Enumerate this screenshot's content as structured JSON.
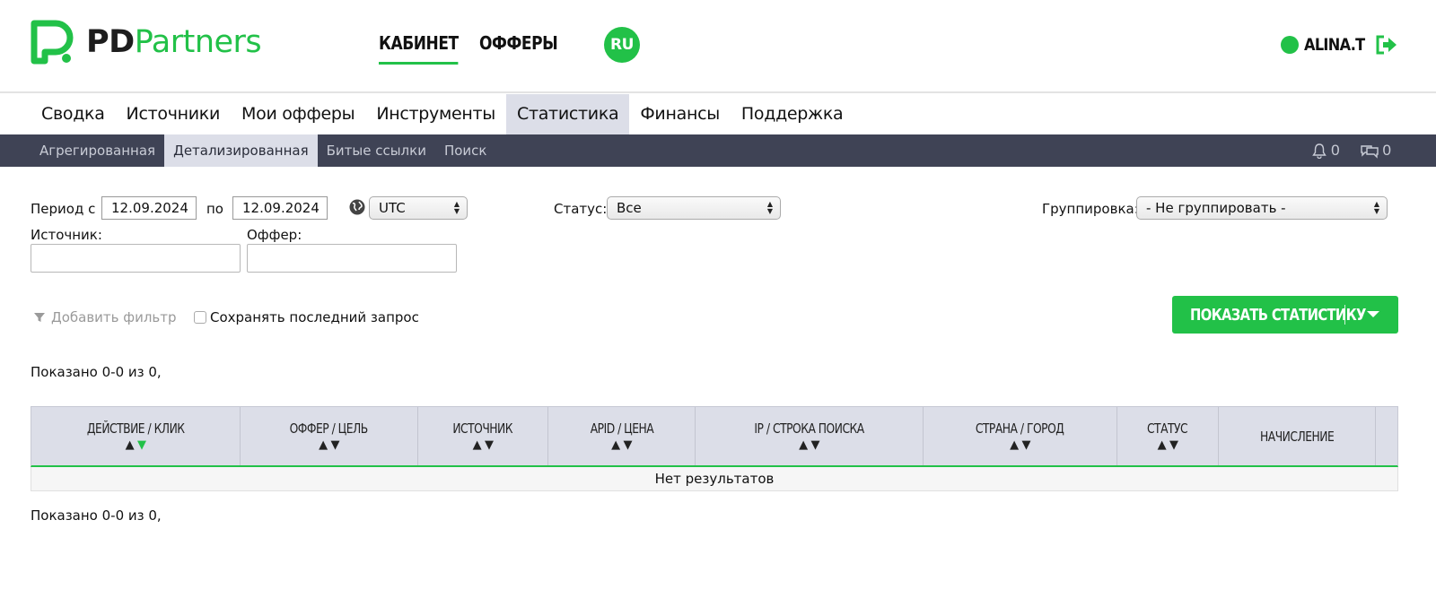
{
  "header": {
    "logo_pd": "PD",
    "logo_partners": "Partners",
    "nav": [
      {
        "label": "КАБИНЕТ",
        "active": true
      },
      {
        "label": "ОФФЕРЫ",
        "active": false
      }
    ],
    "lang": "RU",
    "user": "ALINA.T",
    "accent_color": "#22c148"
  },
  "main_menu": [
    {
      "label": "Сводка"
    },
    {
      "label": "Источники"
    },
    {
      "label": "Мои офферы"
    },
    {
      "label": "Инструменты"
    },
    {
      "label": "Статистика",
      "active": true
    },
    {
      "label": "Финансы"
    },
    {
      "label": "Поддержка"
    }
  ],
  "sub_menu": [
    {
      "label": "Агрегированная"
    },
    {
      "label": "Детализированная",
      "active": true
    },
    {
      "label": "Битые ссылки"
    },
    {
      "label": "Поиск"
    }
  ],
  "counters": {
    "notifications": "0",
    "messages": "0"
  },
  "filters": {
    "period_from_label": "Период с",
    "date_from": "12.09.2024",
    "period_to_label": "по",
    "date_to": "12.09.2024",
    "timezone": "UTC",
    "status_label": "Статус:",
    "status_value": "Все",
    "grouping_label": "Группировка:",
    "grouping_value": "- Не группировать -",
    "source_label": "Источник:",
    "offer_label": "Оффер:"
  },
  "actions": {
    "add_filter": "Добавить фильтр",
    "save_last_request": "Сохранять последний запрос",
    "show_stats": "ПОКАЗАТЬ СТАТИСТИКУ"
  },
  "shown_text": "Показано 0-0 из 0,",
  "table": {
    "columns": [
      {
        "label": "ДЕЙСТВИЕ / КЛИК",
        "sortable": true
      },
      {
        "label": "ОФФЕР / ЦЕЛЬ",
        "sortable": true
      },
      {
        "label": "ИСТОЧНИК",
        "sortable": true
      },
      {
        "label": "APID / ЦЕНА",
        "sortable": true
      },
      {
        "label": "IP / СТРОКА ПОИСКА",
        "sortable": true
      },
      {
        "label": "СТРАНА / ГОРОД",
        "sortable": true
      },
      {
        "label": "СТАТУС",
        "sortable": true
      },
      {
        "label": "НАЧИСЛЕНИЕ",
        "sortable": false
      },
      {
        "label": "",
        "sortable": false
      }
    ],
    "empty_text": "Нет результатов"
  }
}
